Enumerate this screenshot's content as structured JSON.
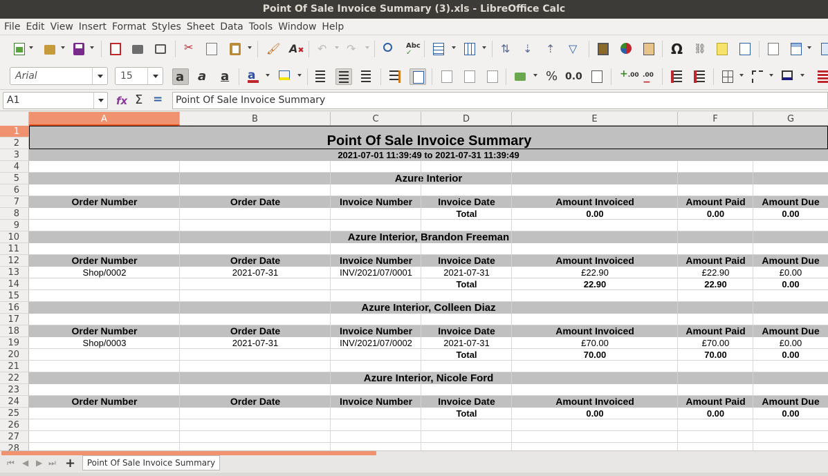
{
  "window": {
    "title": "Point Of Sale Invoice Summary (3).xls - LibreOffice Calc"
  },
  "menu": [
    "File",
    "Edit",
    "View",
    "Insert",
    "Format",
    "Styles",
    "Sheet",
    "Data",
    "Tools",
    "Window",
    "Help"
  ],
  "toolbar": {
    "font_name": "Arial",
    "font_size": "15",
    "percent_label": "%",
    "decimal_label": "0.0",
    "omega_label": "Ω"
  },
  "formula_bar": {
    "cell_ref": "A1",
    "content": "Point Of Sale Invoice Summary"
  },
  "columns": [
    "A",
    "B",
    "C",
    "D",
    "E",
    "F",
    "G"
  ],
  "rows": [
    "1",
    "2",
    "3",
    "4",
    "5",
    "6",
    "7",
    "8",
    "9",
    "10",
    "11",
    "12",
    "13",
    "14",
    "15",
    "16",
    "17",
    "18",
    "19",
    "20",
    "21",
    "22",
    "23",
    "24",
    "25",
    "26",
    "27",
    "28"
  ],
  "report": {
    "title": "Point Of Sale Invoice Summary",
    "date_range": "2021-07-01 11:39:49 to 2021-07-31 11:39:49",
    "column_headers": [
      "Order Number",
      "Order Date",
      "Invoice Number",
      "Invoice Date",
      "Amount Invoiced",
      "Amount Paid",
      "Amount Due"
    ],
    "total_label": "Total",
    "sections": [
      {
        "name": "Azure Interior",
        "lines": [],
        "totals": [
          "0.00",
          "0.00",
          "0.00"
        ]
      },
      {
        "name": "Azure Interior, Brandon Freeman",
        "lines": [
          [
            "Shop/0002",
            "2021-07-31",
            "INV/2021/07/0001",
            "2021-07-31",
            "£22.90",
            "£22.90",
            "£0.00"
          ]
        ],
        "totals": [
          "22.90",
          "22.90",
          "0.00"
        ]
      },
      {
        "name": "Azure Interior, Colleen Diaz",
        "lines": [
          [
            "Shop/0003",
            "2021-07-31",
            "INV/2021/07/0002",
            "2021-07-31",
            "£70.00",
            "£70.00",
            "£0.00"
          ]
        ],
        "totals": [
          "70.00",
          "70.00",
          "0.00"
        ]
      },
      {
        "name": "Azure Interior, Nicole Ford",
        "lines": [],
        "totals": [
          "0.00",
          "0.00",
          "0.00"
        ]
      }
    ]
  },
  "sheet_tab": {
    "name": "Point Of Sale Invoice Summary"
  }
}
